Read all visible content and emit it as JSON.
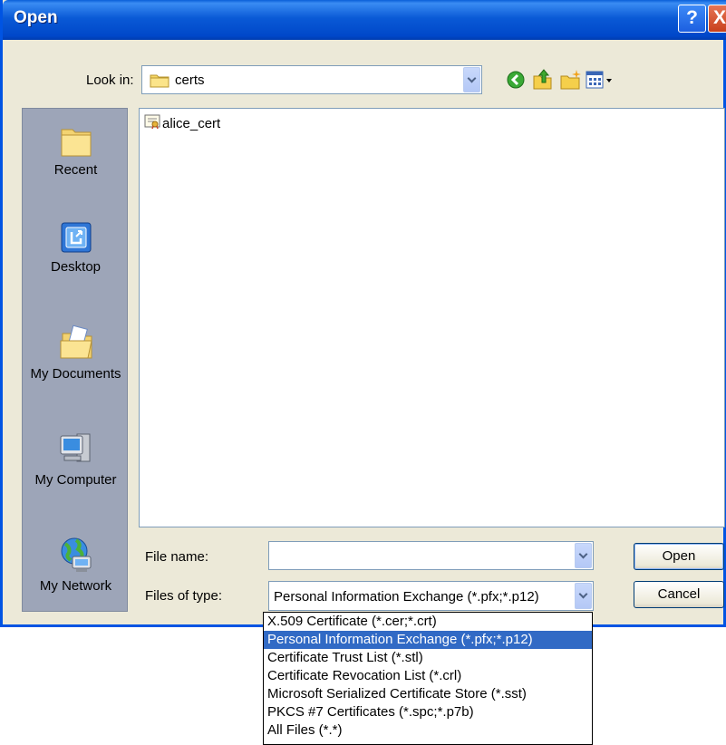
{
  "window": {
    "title": "Open",
    "help_glyph": "?",
    "close_glyph": "X"
  },
  "look_in": {
    "label": "Look in:",
    "value": "certs"
  },
  "toolbar": {
    "icons": [
      "back-icon",
      "up-folder-icon",
      "new-folder-icon",
      "view-menu-icon"
    ]
  },
  "places": [
    {
      "label": "Recent",
      "icon": "recent-folder-icon"
    },
    {
      "label": "Desktop",
      "icon": "desktop-icon"
    },
    {
      "label": "My Documents",
      "icon": "my-documents-icon"
    },
    {
      "label": "My Computer",
      "icon": "my-computer-icon"
    },
    {
      "label": "My Network",
      "icon": "my-network-icon"
    }
  ],
  "files": [
    {
      "name": "alice_cert",
      "icon": "certificate-file-icon"
    }
  ],
  "file_name": {
    "label": "File name:",
    "value": ""
  },
  "file_type": {
    "label": "Files of type:",
    "value": "Personal Information Exchange (*.pfx;*.p12)"
  },
  "buttons": {
    "open": "Open",
    "cancel": "Cancel"
  },
  "type_options": [
    "X.509 Certificate (*.cer;*.crt)",
    "Personal Information Exchange (*.pfx;*.p12)",
    "Certificate Trust List (*.stl)",
    "Certificate Revocation List (*.crl)",
    "Microsoft Serialized Certificate Store (*.sst)",
    "PKCS #7 Certificates (*.spc;*.p7b)",
    "All Files (*.*)"
  ],
  "selected_type_index": 1,
  "colors": {
    "titlebar": "#0054e3",
    "dialog_bg": "#ece9d8",
    "places_bg": "#9da5b8",
    "selection": "#316ac5"
  }
}
